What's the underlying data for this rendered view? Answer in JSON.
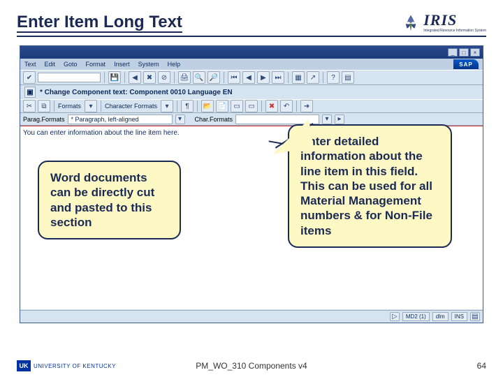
{
  "title": "Enter Item Long Text",
  "iris": {
    "label": "IRIS",
    "sub": "Integrated Resource Information System"
  },
  "sap": {
    "menu": {
      "items": [
        "Text",
        "Edit",
        "Goto",
        "Format",
        "Insert",
        "System",
        "Help"
      ]
    },
    "logo": "SAP",
    "subtitle": "* Change Component text: Component 0010 Language EN",
    "toolbar2": {
      "formats_lbl": "Formats",
      "char_formats_lbl": "Character Formats",
      "para_btn": "¶"
    },
    "datarow": {
      "parag_lbl": "Parag.Formats",
      "parag_val": "* Paragraph, left-aligned",
      "char_lbl": "Char.Formats",
      "char_val": ""
    },
    "editor_text": "You can enter information about the line item here.",
    "status": {
      "v1": "MD2 (1)",
      "v2": "dlm",
      "v3": "INS"
    }
  },
  "callouts": {
    "left": "Word documents can be directly cut and pasted to this section",
    "right": "Enter detailed information about the line item in this field. This can be used for all Material Management numbers & for Non-File items"
  },
  "footer": {
    "uk": "UK",
    "uk_text": "UNIVERSITY OF KENTUCKY",
    "center": "PM_WO_310 Components v4",
    "page": "64"
  }
}
